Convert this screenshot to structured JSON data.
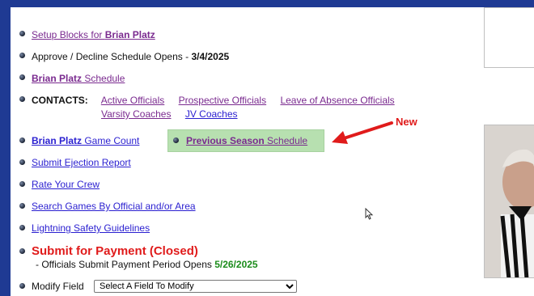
{
  "links": {
    "setup_prefix": "Setup Blocks for ",
    "official_name": "Brian Platz",
    "schedule_suffix": " Schedule",
    "game_count_suffix": " Game Count",
    "previous_season_bold": "Previous Season",
    "previous_season_suffix": " Schedule",
    "submit_ejection": "Submit Ejection Report",
    "rate_crew": "Rate Your Crew",
    "search_games": "Search Games By Official and/or Area",
    "lightning": "Lightning Safety Guidelines"
  },
  "approve": {
    "text": "Approve / Decline Schedule Opens - ",
    "date": "3/4/2025"
  },
  "contacts": {
    "label": "CONTACTS:",
    "items": [
      "Active Officials",
      "Prospective Officials",
      "Leave of Absence Officials",
      "Varsity Coaches",
      "JV Coaches"
    ]
  },
  "annotation": {
    "new_label": "New",
    "color": "#e01b1b"
  },
  "payment": {
    "title": "Submit for Payment (Closed)",
    "note_prefix": "- Officials Submit Payment Period Opens ",
    "note_date": "5/26/2025"
  },
  "modify": {
    "label": "Modify Field",
    "select_value": "Select A Field To Modify"
  },
  "icons": [
    "bullet-icon",
    "cursor-icon",
    "arrow-icon"
  ],
  "colors": {
    "nav_bar": "#1f3a93",
    "highlight": "#b7e0b0",
    "link": "#2a1fd0",
    "visited": "#7a2a8f"
  }
}
